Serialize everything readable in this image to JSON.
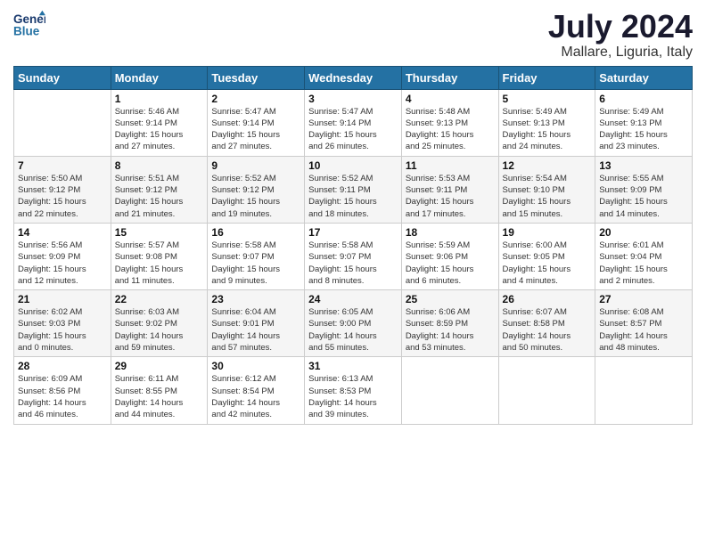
{
  "logo": {
    "line1": "General",
    "line2": "Blue"
  },
  "title": "July 2024",
  "subtitle": "Mallare, Liguria, Italy",
  "days_of_week": [
    "Sunday",
    "Monday",
    "Tuesday",
    "Wednesday",
    "Thursday",
    "Friday",
    "Saturday"
  ],
  "weeks": [
    [
      {
        "day": "",
        "info": ""
      },
      {
        "day": "1",
        "info": "Sunrise: 5:46 AM\nSunset: 9:14 PM\nDaylight: 15 hours\nand 27 minutes."
      },
      {
        "day": "2",
        "info": "Sunrise: 5:47 AM\nSunset: 9:14 PM\nDaylight: 15 hours\nand 27 minutes."
      },
      {
        "day": "3",
        "info": "Sunrise: 5:47 AM\nSunset: 9:14 PM\nDaylight: 15 hours\nand 26 minutes."
      },
      {
        "day": "4",
        "info": "Sunrise: 5:48 AM\nSunset: 9:13 PM\nDaylight: 15 hours\nand 25 minutes."
      },
      {
        "day": "5",
        "info": "Sunrise: 5:49 AM\nSunset: 9:13 PM\nDaylight: 15 hours\nand 24 minutes."
      },
      {
        "day": "6",
        "info": "Sunrise: 5:49 AM\nSunset: 9:13 PM\nDaylight: 15 hours\nand 23 minutes."
      }
    ],
    [
      {
        "day": "7",
        "info": "Sunrise: 5:50 AM\nSunset: 9:12 PM\nDaylight: 15 hours\nand 22 minutes."
      },
      {
        "day": "8",
        "info": "Sunrise: 5:51 AM\nSunset: 9:12 PM\nDaylight: 15 hours\nand 21 minutes."
      },
      {
        "day": "9",
        "info": "Sunrise: 5:52 AM\nSunset: 9:12 PM\nDaylight: 15 hours\nand 19 minutes."
      },
      {
        "day": "10",
        "info": "Sunrise: 5:52 AM\nSunset: 9:11 PM\nDaylight: 15 hours\nand 18 minutes."
      },
      {
        "day": "11",
        "info": "Sunrise: 5:53 AM\nSunset: 9:11 PM\nDaylight: 15 hours\nand 17 minutes."
      },
      {
        "day": "12",
        "info": "Sunrise: 5:54 AM\nSunset: 9:10 PM\nDaylight: 15 hours\nand 15 minutes."
      },
      {
        "day": "13",
        "info": "Sunrise: 5:55 AM\nSunset: 9:09 PM\nDaylight: 15 hours\nand 14 minutes."
      }
    ],
    [
      {
        "day": "14",
        "info": "Sunrise: 5:56 AM\nSunset: 9:09 PM\nDaylight: 15 hours\nand 12 minutes."
      },
      {
        "day": "15",
        "info": "Sunrise: 5:57 AM\nSunset: 9:08 PM\nDaylight: 15 hours\nand 11 minutes."
      },
      {
        "day": "16",
        "info": "Sunrise: 5:58 AM\nSunset: 9:07 PM\nDaylight: 15 hours\nand 9 minutes."
      },
      {
        "day": "17",
        "info": "Sunrise: 5:58 AM\nSunset: 9:07 PM\nDaylight: 15 hours\nand 8 minutes."
      },
      {
        "day": "18",
        "info": "Sunrise: 5:59 AM\nSunset: 9:06 PM\nDaylight: 15 hours\nand 6 minutes."
      },
      {
        "day": "19",
        "info": "Sunrise: 6:00 AM\nSunset: 9:05 PM\nDaylight: 15 hours\nand 4 minutes."
      },
      {
        "day": "20",
        "info": "Sunrise: 6:01 AM\nSunset: 9:04 PM\nDaylight: 15 hours\nand 2 minutes."
      }
    ],
    [
      {
        "day": "21",
        "info": "Sunrise: 6:02 AM\nSunset: 9:03 PM\nDaylight: 15 hours\nand 0 minutes."
      },
      {
        "day": "22",
        "info": "Sunrise: 6:03 AM\nSunset: 9:02 PM\nDaylight: 14 hours\nand 59 minutes."
      },
      {
        "day": "23",
        "info": "Sunrise: 6:04 AM\nSunset: 9:01 PM\nDaylight: 14 hours\nand 57 minutes."
      },
      {
        "day": "24",
        "info": "Sunrise: 6:05 AM\nSunset: 9:00 PM\nDaylight: 14 hours\nand 55 minutes."
      },
      {
        "day": "25",
        "info": "Sunrise: 6:06 AM\nSunset: 8:59 PM\nDaylight: 14 hours\nand 53 minutes."
      },
      {
        "day": "26",
        "info": "Sunrise: 6:07 AM\nSunset: 8:58 PM\nDaylight: 14 hours\nand 50 minutes."
      },
      {
        "day": "27",
        "info": "Sunrise: 6:08 AM\nSunset: 8:57 PM\nDaylight: 14 hours\nand 48 minutes."
      }
    ],
    [
      {
        "day": "28",
        "info": "Sunrise: 6:09 AM\nSunset: 8:56 PM\nDaylight: 14 hours\nand 46 minutes."
      },
      {
        "day": "29",
        "info": "Sunrise: 6:11 AM\nSunset: 8:55 PM\nDaylight: 14 hours\nand 44 minutes."
      },
      {
        "day": "30",
        "info": "Sunrise: 6:12 AM\nSunset: 8:54 PM\nDaylight: 14 hours\nand 42 minutes."
      },
      {
        "day": "31",
        "info": "Sunrise: 6:13 AM\nSunset: 8:53 PM\nDaylight: 14 hours\nand 39 minutes."
      },
      {
        "day": "",
        "info": ""
      },
      {
        "day": "",
        "info": ""
      },
      {
        "day": "",
        "info": ""
      }
    ]
  ]
}
